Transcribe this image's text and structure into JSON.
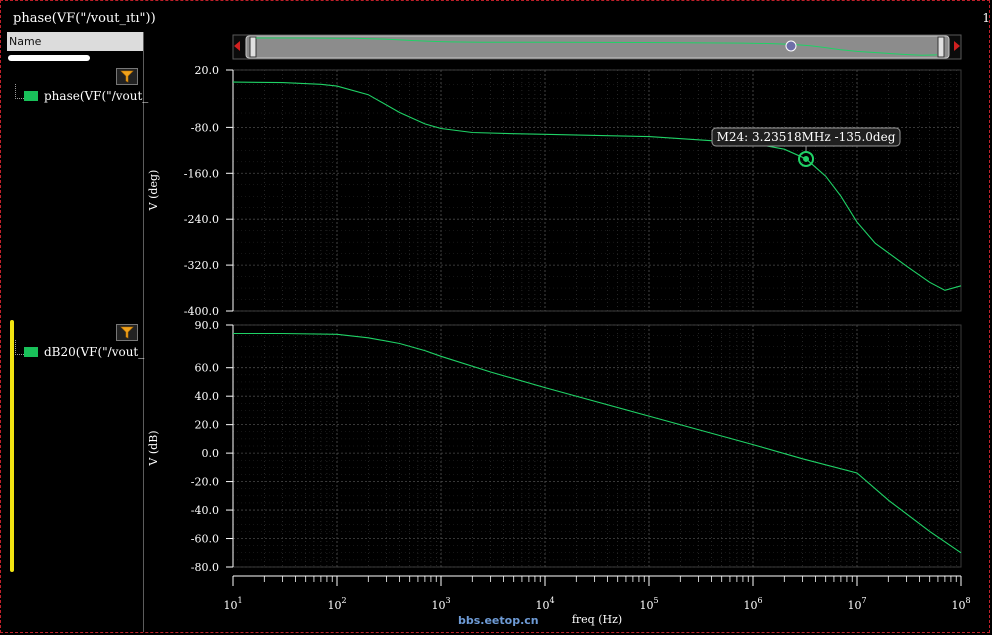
{
  "window": {
    "title": "phase(VF(\"/vout_ıtı\"))",
    "number": "1"
  },
  "panel": {
    "header": "Name",
    "traces": [
      {
        "label": "phase(VF(\"/vout_",
        "color": "#19c15a"
      },
      {
        "label": "dB20(VF(\"/vout_",
        "color": "#19c15a"
      }
    ]
  },
  "colors": {
    "trace": "#1fd266",
    "grid": "#4a4a4a",
    "background": "#000000",
    "marker": "#1fd266"
  },
  "chart_data": [
    {
      "type": "line",
      "ylabel": "V (deg)",
      "ylim": [
        -400,
        20
      ],
      "yticks": [
        "20.0",
        "-80.0",
        "-160.0",
        "-240.0",
        "-320.0",
        "-400.0"
      ],
      "ytick_values": [
        20,
        -80,
        -160,
        -240,
        -320,
        -400
      ],
      "xscale": "log",
      "series": [
        {
          "x": [
            10,
            30,
            70,
            100,
            200,
            400,
            700,
            1000,
            2000,
            5000,
            10000,
            100000,
            1000000,
            2000000,
            3235180,
            5000000,
            7000000,
            10000000,
            15000000,
            30000000,
            50000000,
            70000000,
            100000000
          ],
          "values": [
            -1,
            -2,
            -5,
            -8,
            -23,
            -54,
            -74,
            -82,
            -89,
            -91,
            -92,
            -96,
            -108,
            -118,
            -135,
            -165,
            -200,
            -245,
            -282,
            -322,
            -350,
            -364,
            -356
          ]
        }
      ],
      "marker": {
        "label": "M24: 3.23518MHz -135.0deg",
        "x": 3235180,
        "y": -135.0
      }
    },
    {
      "type": "line",
      "ylabel": "V (dB)",
      "xlabel": "freq (Hz)",
      "ylim": [
        -80,
        90
      ],
      "yticks": [
        "90.0",
        "60.0",
        "40.0",
        "20.0",
        "0.0",
        "-20.0",
        "-40.0",
        "-60.0",
        "-80.0"
      ],
      "ytick_values": [
        90,
        60,
        40,
        20,
        0,
        -20,
        -40,
        -60,
        -80
      ],
      "xscale": "log",
      "xlim": [
        10,
        100000000
      ],
      "xticks": [
        "10",
        "10",
        "10",
        "10",
        "10",
        "10",
        "10",
        "10"
      ],
      "xtick_exponents": [
        "1",
        "2",
        "3",
        "4",
        "5",
        "6",
        "7",
        "8"
      ],
      "series": [
        {
          "x": [
            10,
            30,
            100,
            200,
            400,
            700,
            1000,
            3000,
            10000,
            100000,
            1000000,
            3000000,
            10000000,
            20000000,
            50000000,
            100000000
          ],
          "values": [
            84,
            84,
            83.5,
            81,
            77,
            72,
            68,
            57,
            46,
            26,
            6,
            -4,
            -14,
            -33,
            -55,
            -70
          ]
        }
      ]
    }
  ],
  "watermark": "bbs.eetop.cn"
}
